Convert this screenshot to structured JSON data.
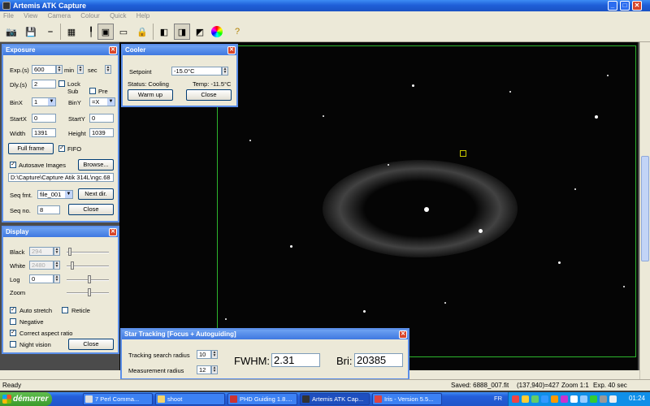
{
  "window": {
    "title": "Artemis ATK Capture"
  },
  "menu": [
    "File",
    "View",
    "Camera",
    "Colour",
    "Quick",
    "Help"
  ],
  "toolbar": {
    "icons": [
      "camera-icon",
      "save-icon",
      "settings-icon",
      "image-icon",
      "focus-icon",
      "frame-icon",
      "roi-icon",
      "lock-icon",
      "reticle-icon",
      "capture-icon",
      "export-icon",
      "color-wheel-icon",
      "help-icon"
    ]
  },
  "exposure": {
    "title": "Exposure",
    "exp_label": "Exp.(s)",
    "exp_value": "600",
    "min_label": "min",
    "sec_label": "sec",
    "dly_label": "Dly.(s)",
    "dly_value": "2",
    "lock_label": "Lock",
    "sub_label": "Sub",
    "pre_label": "Pre",
    "binx_label": "BinX",
    "binx_value": "1",
    "biny_label": "BinY",
    "biny_value": "=X",
    "startx_label": "StartX",
    "startx_value": "0",
    "starty_label": "StartY",
    "starty_value": "0",
    "width_label": "Width",
    "width_value": "1391",
    "height_label": "Height",
    "height_value": "1039",
    "fullframe_label": "Full frame",
    "fifo_label": "FIFO",
    "fifo_checked": true,
    "autosave_label": "Autosave Images",
    "autosave_checked": true,
    "browse_label": "Browse...",
    "path_value": "D:\\Capture\\Capture Atik 314L\\ngc.68",
    "seqfmt_label": "Seq fmt.",
    "seqfmt_value": "file_001",
    "nextdir_label": "Next dir.",
    "seqno_label": "Seq no.",
    "seqno_value": "8",
    "close_label": "Close"
  },
  "display": {
    "title": "Display",
    "black_label": "Black",
    "black_value": "294",
    "white_label": "White",
    "white_value": "2480",
    "log_label": "Log",
    "log_value": "0",
    "zoom_label": "Zoom",
    "autostretch_label": "Auto stretch",
    "autostretch_checked": true,
    "reticle_label": "Reticle",
    "reticle_checked": false,
    "negative_label": "Negative",
    "negative_checked": false,
    "aspect_label": "Correct aspect ratio",
    "aspect_checked": true,
    "night_label": "Night vision",
    "night_checked": false,
    "close_label": "Close"
  },
  "cooler": {
    "title": "Cooler",
    "setpoint_label": "Setpoint",
    "setpoint_value": "-15.0°C",
    "status_text": "Status: Cooling",
    "temp_text": "Temp: -11.5°C",
    "warmup_label": "Warm up",
    "close_label": "Close"
  },
  "tracking": {
    "title": "Star Tracking [Focus + Autoguiding]",
    "search_label": "Tracking search radius",
    "search_value": "10",
    "meas_label": "Measurement radius",
    "meas_value": "12",
    "fwhm_label": "FWHM:",
    "fwhm_value": "2.31",
    "bri_label": "Bri:",
    "bri_value": "20385"
  },
  "status": {
    "left": "Ready",
    "saved": "Saved: 6888_007.fit",
    "coords": "(137,940)=427",
    "zoom": "Zoom 1:1",
    "exp": "Exp. 40 sec"
  },
  "taskbar": {
    "start_label": "démarrer",
    "tasks": [
      {
        "label": "7 Perl Comma..."
      },
      {
        "label": "shoot"
      },
      {
        "label": "PHD Guiding 1.8...."
      },
      {
        "label": "Artemis ATK Cap..."
      },
      {
        "label": "Iris - Version 5.5..."
      }
    ],
    "lang": "FR",
    "clock": "01:24"
  }
}
